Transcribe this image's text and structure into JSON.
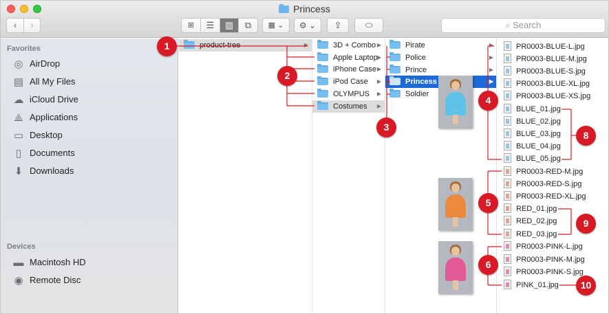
{
  "window": {
    "title": "Princess"
  },
  "toolbar": {
    "back": "‹",
    "forward": "›",
    "view_icons": "⊞",
    "view_list": "☰",
    "view_columns": "▥",
    "view_cover": "⧉",
    "arrange": "▦ ⌄",
    "action": "⚙ ⌄",
    "share": "⇪",
    "tag": "⬭",
    "search_placeholder": "Search"
  },
  "sidebar": {
    "favorites_heading": "Favorites",
    "favorites": [
      {
        "label": "AirDrop",
        "icon": "airdrop-icon",
        "glyph": "◎"
      },
      {
        "label": "All My Files",
        "icon": "all-files-icon",
        "glyph": "▤"
      },
      {
        "label": "iCloud Drive",
        "icon": "cloud-icon",
        "glyph": "☁"
      },
      {
        "label": "Applications",
        "icon": "applications-icon",
        "glyph": "⟁"
      },
      {
        "label": "Desktop",
        "icon": "desktop-icon",
        "glyph": "▭"
      },
      {
        "label": "Documents",
        "icon": "documents-icon",
        "glyph": "▯"
      },
      {
        "label": "Downloads",
        "icon": "downloads-icon",
        "glyph": "⬇"
      }
    ],
    "devices_heading": "Devices",
    "devices": [
      {
        "label": "Macintosh HD",
        "icon": "hard-drive-icon",
        "glyph": "▬"
      },
      {
        "label": "Remote Disc",
        "icon": "disc-icon",
        "glyph": "◉"
      }
    ]
  },
  "columns": {
    "col1": [
      "product-tree"
    ],
    "col2": [
      "3D + Combo",
      "Apple Laptop",
      "iPhone Case",
      "iPod Case",
      "OLYMPUS",
      "Costumes"
    ],
    "col3": [
      "Pirate",
      "Police",
      "Prince",
      "Princess",
      "Soldier"
    ],
    "files": [
      {
        "name": "PR0003-BLUE-L.jpg",
        "color": "blue"
      },
      {
        "name": "PR0003-BLUE-M.jpg",
        "color": "blue"
      },
      {
        "name": "PR0003-BLUE-S.jpg",
        "color": "blue"
      },
      {
        "name": "PR0003-BLUE-XL.jpg",
        "color": "blue"
      },
      {
        "name": "PR0003-BLUE-XS.jpg",
        "color": "blue"
      },
      {
        "name": "BLUE_01.jpg",
        "color": "blue"
      },
      {
        "name": "BLUE_02.jpg",
        "color": "blue"
      },
      {
        "name": "BLUE_03.jpg",
        "color": "blue"
      },
      {
        "name": "BLUE_04.jpg",
        "color": "blue"
      },
      {
        "name": "BLUE_05.jpg",
        "color": "blue"
      },
      {
        "name": "PR0003-RED-M.jpg",
        "color": "red"
      },
      {
        "name": "PR0003-RED-S.jpg",
        "color": "red"
      },
      {
        "name": "PR0003-RED-XL.jpg",
        "color": "red"
      },
      {
        "name": "RED_01.jpg",
        "color": "red"
      },
      {
        "name": "RED_02.jpg",
        "color": "red"
      },
      {
        "name": "RED_03.jpg",
        "color": "red"
      },
      {
        "name": "PR0003-PINK-L.jpg",
        "color": "pink"
      },
      {
        "name": "PR0003-PINK-M.jpg",
        "color": "pink"
      },
      {
        "name": "PR0003-PINK-S.jpg",
        "color": "pink"
      },
      {
        "name": "PINK_01.jpg",
        "color": "pink"
      }
    ]
  },
  "callouts": [
    "1",
    "2",
    "3",
    "4",
    "5",
    "6",
    "8",
    "9",
    "10"
  ],
  "colors": {
    "callout": "#d71a25",
    "selection": "#1b6ad7",
    "folder": "#77bff0"
  }
}
